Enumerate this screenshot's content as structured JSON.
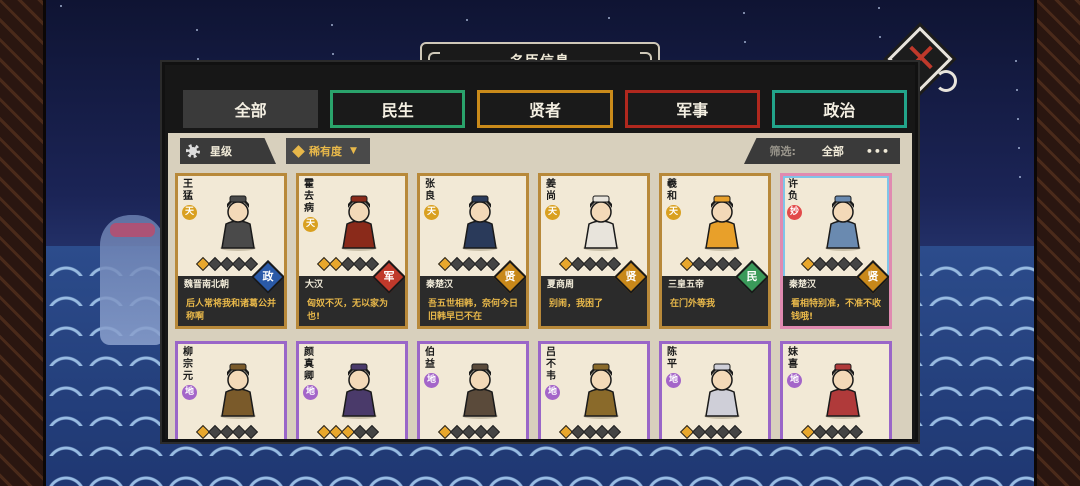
{
  "title": "名臣信息",
  "tabs": [
    {
      "label": "全部",
      "active": true
    },
    {
      "label": "民生"
    },
    {
      "label": "贤者"
    },
    {
      "label": "军事"
    },
    {
      "label": "政治"
    }
  ],
  "filter_bar": {
    "star_label": "星级",
    "rarity_label": "稀有度",
    "filter_label": "筛选:",
    "filter_value": "全部",
    "more": "•••"
  },
  "close_icon": "close-x-icon",
  "colors": {
    "gold_border": "#b8893a",
    "purple_border": "#9a66c8",
    "tab_minsheng": "#2aa36b",
    "tab_xianzhe": "#c98a1a",
    "tab_junshi": "#b0281e",
    "tab_zhengzhi": "#22a48a"
  },
  "cards": [
    {
      "name": "王猛",
      "grade": "天",
      "stars": 1,
      "era": "魏晋南北朝",
      "type": "政",
      "quote": "后人常将我和诸葛公并称啊"
    },
    {
      "name": "霍去病",
      "grade": "天",
      "stars": 2,
      "era": "大汉",
      "type": "军",
      "quote": "匈奴不灭，无以家为也!"
    },
    {
      "name": "张良",
      "grade": "天",
      "stars": 1,
      "era": "秦楚汉",
      "type": "贤",
      "quote": "吾五世相韩，奈何今日旧韩早已不在"
    },
    {
      "name": "姜尚",
      "grade": "天",
      "stars": 1,
      "era": "夏商周",
      "type": "贤",
      "quote": "别闹，我困了"
    },
    {
      "name": "羲和",
      "grade": "天",
      "stars": 1,
      "era": "三皇五帝",
      "type": "民",
      "quote": "在门外等我"
    },
    {
      "name": "许负",
      "grade": "妙",
      "stars": 1,
      "era": "秦楚汉",
      "type": "贤",
      "quote": "看相特别准，不准不收钱哦!"
    },
    {
      "name": "柳宗元",
      "grade": "地",
      "stars": 1
    },
    {
      "name": "颜真卿",
      "grade": "地",
      "stars": 3
    },
    {
      "name": "伯益",
      "grade": "地",
      "stars": 1
    },
    {
      "name": "吕不韦",
      "grade": "地",
      "stars": 1
    },
    {
      "name": "陈平",
      "grade": "地",
      "stars": 1
    },
    {
      "name": "妹喜",
      "grade": "地",
      "stars": 1
    }
  ]
}
